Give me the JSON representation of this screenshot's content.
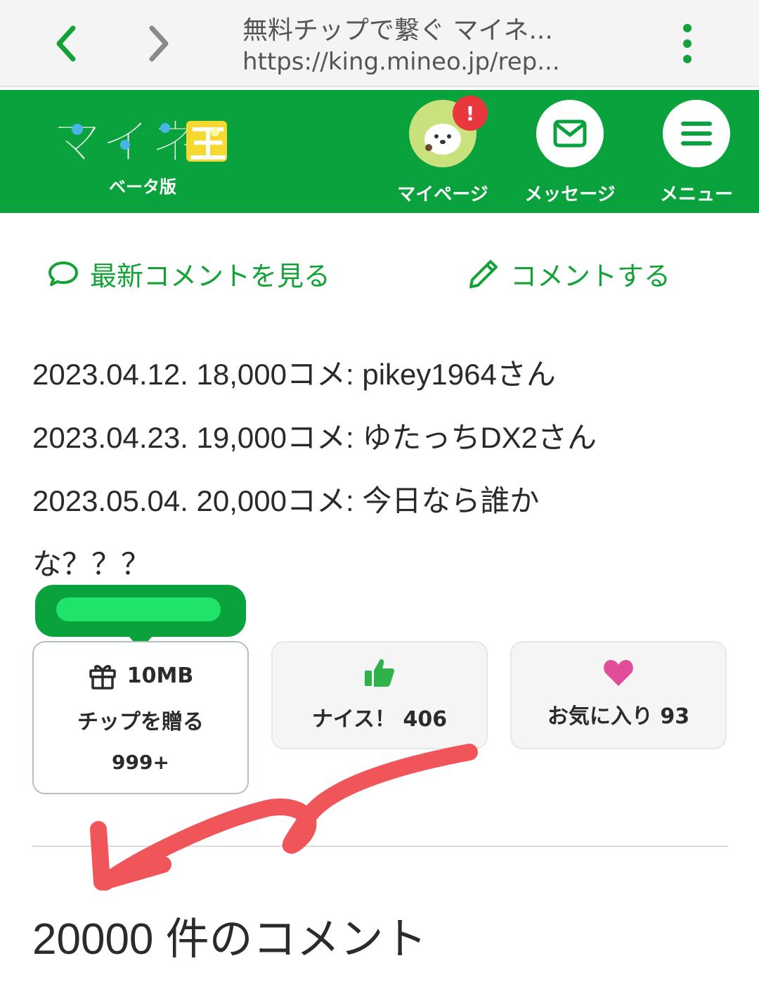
{
  "browser": {
    "title": "無料チップで繋ぐ マイネ...",
    "url": "https://king.mineo.jp/rep..."
  },
  "header": {
    "logo_text": "マイネ王",
    "logo_sub": "ベータ版",
    "mypage_label": "マイページ",
    "notification_badge": "!",
    "message_label": "メッセージ",
    "menu_label": "メニュー"
  },
  "actions": {
    "latest_comments": "最新コメントを見る",
    "post_comment": "コメントする"
  },
  "post": {
    "lines": [
      "2023.04.12. 18,000コメ: pikey1964さん",
      "2023.04.23. 19,000コメ: ゆたっちDX2さん",
      "2023.05.04. 20,000コメ: 今日なら誰か",
      "な？？？"
    ]
  },
  "reactions": {
    "tip_amount": "10MB",
    "tip_label": "チップを贈る",
    "tip_count": "999+",
    "nice_label": "ナイス！ 406",
    "fav_label": "お気に入り 93"
  },
  "comments": {
    "count_label": "20000 件のコメント"
  },
  "colors": {
    "brand_green": "#0aa23c",
    "link_green": "#13a236",
    "annotation_red": "#f0555a",
    "heart_pink": "#e24d9a"
  }
}
